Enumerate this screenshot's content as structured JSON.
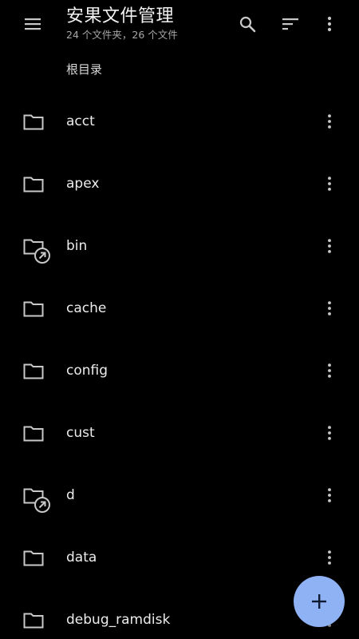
{
  "header": {
    "title": "安果文件管理",
    "subtitle": "24 个文件夹，26 个文件",
    "icons": [
      "menu-icon",
      "search-icon",
      "sort-icon",
      "more-vert-icon"
    ]
  },
  "breadcrumb": {
    "label": "根目录"
  },
  "files": [
    {
      "name": "acct",
      "type": "folder",
      "symlink": false
    },
    {
      "name": "apex",
      "type": "folder",
      "symlink": false
    },
    {
      "name": "bin",
      "type": "folder",
      "symlink": true
    },
    {
      "name": "cache",
      "type": "folder",
      "symlink": false
    },
    {
      "name": "config",
      "type": "folder",
      "symlink": false
    },
    {
      "name": "cust",
      "type": "folder",
      "symlink": false
    },
    {
      "name": "d",
      "type": "folder",
      "symlink": true
    },
    {
      "name": "data",
      "type": "folder",
      "symlink": false
    },
    {
      "name": "debug_ramdisk",
      "type": "folder",
      "symlink": false
    }
  ],
  "fab": {
    "icon": "plus-icon"
  },
  "colors": {
    "background": "#000000",
    "icon": "#c8c8c8",
    "fab": "#8fb2f5",
    "fab_icon": "#0f1a33"
  }
}
